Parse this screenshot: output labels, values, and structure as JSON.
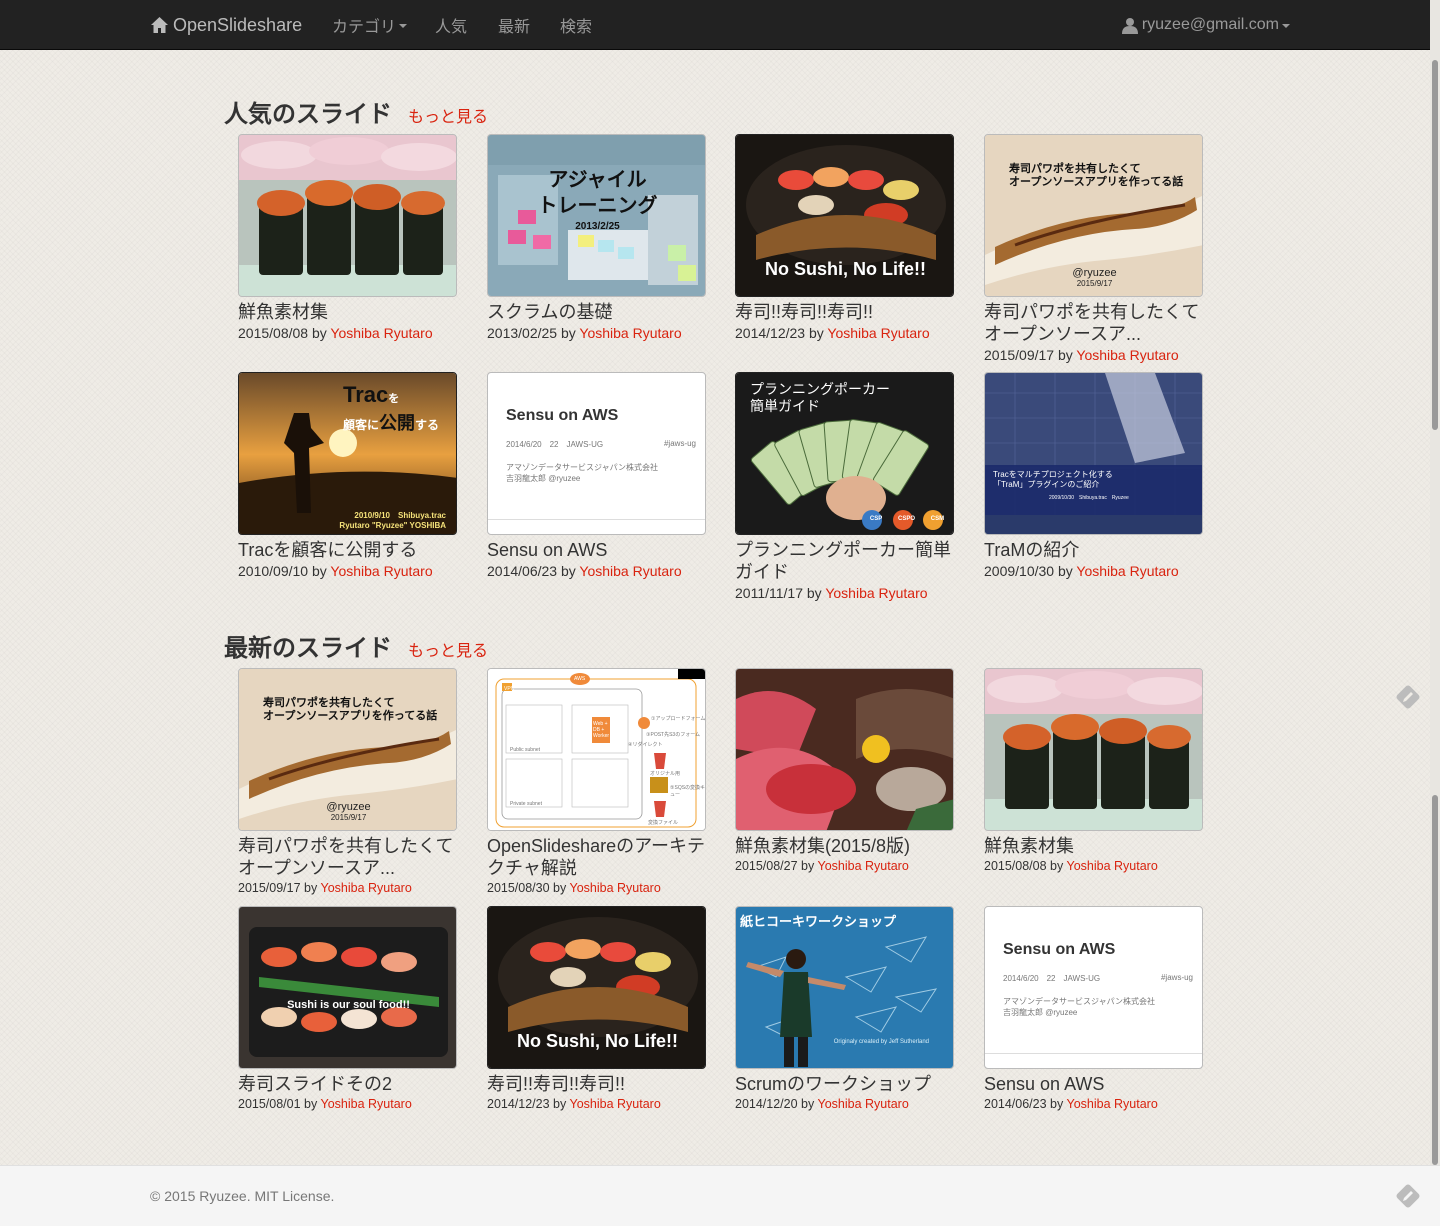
{
  "nav": {
    "brand": "OpenSlideshare",
    "items": [
      {
        "label": "カテゴリ"
      },
      {
        "label": "人気"
      },
      {
        "label": "最新"
      },
      {
        "label": "検索"
      }
    ],
    "user": "ryuzee@gmail.com"
  },
  "popular": {
    "title": "人気のスライド",
    "more": "もっと見る",
    "slides": [
      {
        "title": "鮮魚素材集",
        "date": "2015/08/08",
        "by": "by",
        "author": "Yoshiba Ryutaro"
      },
      {
        "title": "スクラムの基礎",
        "date": "2013/02/25",
        "by": "by",
        "author": "Yoshiba Ryutaro",
        "overlay": [
          "アジャイル",
          "トレーニング",
          "2013/2/25"
        ]
      },
      {
        "title": "寿司!!寿司!!寿司!!",
        "date": "2014/12/23",
        "by": "by",
        "author": "Yoshiba Ryutaro",
        "overlay": [
          "No Sushi, No Life!!"
        ]
      },
      {
        "title": "寿司パワポを共有したくてオープンソースア...",
        "date": "2015/09/17",
        "by": "by",
        "author": "Yoshiba Ryutaro",
        "overlay": [
          "寿司パワポを共有したくて",
          "オープンソースアプリを作ってる話",
          "@ryuzee",
          "2015/9/17"
        ]
      },
      {
        "title": "Tracを顧客に公開する",
        "date": "2010/09/10",
        "by": "by",
        "author": "Yoshiba Ryutaro",
        "overlay": [
          "Trac",
          "を",
          "顧客に",
          "公開",
          "する",
          "2010/9/10　Shibuya.trac",
          "Ryutaro \"Ryuzee\" YOSHIBA"
        ]
      },
      {
        "title": "Sensu on AWS",
        "date": "2014/06/23",
        "by": "by",
        "author": "Yoshiba Ryutaro",
        "overlay": [
          "Sensu on AWS",
          "2014/6/20　22　JAWS-UG",
          "#jaws-ug",
          "アマゾンデータサービスジャパン株式会社",
          "吉羽龍太郎 @ryuzee"
        ]
      },
      {
        "title": "プランニングポーカー簡単ガイド",
        "date": "2011/11/17",
        "by": "by",
        "author": "Yoshiba Ryutaro",
        "overlay": [
          "プランニングポーカー",
          "簡単ガイド",
          "CSP",
          "CSPO",
          "CSM"
        ]
      },
      {
        "title": "TraMの紹介",
        "date": "2009/10/30",
        "by": "by",
        "author": "Yoshiba Ryutaro",
        "overlay": [
          "Tracをマルチプロジェクト化する",
          "「TraM」プラグインのご紹介",
          "2009/10/30　Shibuya.trac　Ryuzee"
        ]
      }
    ]
  },
  "latest": {
    "title": "最新のスライド",
    "more": "もっと見る",
    "slides": [
      {
        "title": "寿司パワポを共有したくてオープンソースア...",
        "date": "2015/09/17",
        "by": "by",
        "author": "Yoshiba Ryutaro",
        "overlay": [
          "寿司パワポを共有したくて",
          "オープンソースアプリを作ってる話",
          "@ryuzee",
          "2015/9/17"
        ]
      },
      {
        "title": "OpenSlideshareのアーキテクチャ解説",
        "date": "2015/08/30",
        "by": "by",
        "author": "Yoshiba Ryutaro",
        "overlay": [
          "AWS",
          "VPC",
          "Web + DB + Worker",
          "①アップロードフォーム",
          "③POST先S3のフォーム",
          "④リダイレクト",
          "オリジナル用",
          "⑤SQSの変換キュー",
          "変換ファイル",
          "Public subnet",
          "Private subnet"
        ]
      },
      {
        "title": "鮮魚素材集(2015/8版)",
        "date": "2015/08/27",
        "by": "by",
        "author": "Yoshiba Ryutaro"
      },
      {
        "title": "鮮魚素材集",
        "date": "2015/08/08",
        "by": "by",
        "author": "Yoshiba Ryutaro"
      },
      {
        "title": "寿司スライドその2",
        "date": "2015/08/01",
        "by": "by",
        "author": "Yoshiba Ryutaro",
        "overlay": [
          "Sushi is our soul food!!"
        ]
      },
      {
        "title": "寿司!!寿司!!寿司!!",
        "date": "2014/12/23",
        "by": "by",
        "author": "Yoshiba Ryutaro",
        "overlay": [
          "No Sushi, No Life!!"
        ]
      },
      {
        "title": "Scrumのワークショップ",
        "date": "2014/12/20",
        "by": "by",
        "author": "Yoshiba Ryutaro",
        "overlay": [
          "紙ヒコーキワークショップ",
          "Originaly created by Jeff Sutherland"
        ]
      },
      {
        "title": "Sensu on AWS",
        "date": "2014/06/23",
        "by": "by",
        "author": "Yoshiba Ryutaro",
        "overlay": [
          "Sensu on AWS",
          "2014/6/20　22　JAWS-UG",
          "#jaws-ug",
          "アマゾンデータサービスジャパン株式会社",
          "吉羽龍太郎 @ryuzee"
        ]
      }
    ]
  },
  "footer": {
    "text": "© 2015  Ryuzee. MIT License."
  },
  "colors": {
    "accent": "#d9230f",
    "navbar": "#222222"
  },
  "icons": {
    "brand": "home-icon",
    "user": "user-icon",
    "feedback": "feedback-icon"
  }
}
